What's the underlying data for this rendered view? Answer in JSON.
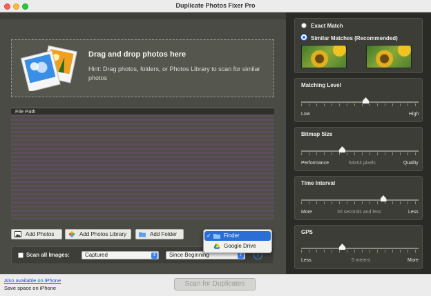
{
  "window": {
    "title": "Duplicate Photos Fixer Pro"
  },
  "dropzone": {
    "title": "Drag and drop photos here",
    "hint": "Hint: Drag photos, folders, or Photos Library to scan for similar photos"
  },
  "file_table": {
    "header": "File Path"
  },
  "buttons": {
    "add_photos": "Add Photos",
    "add_photos_library": "Add Photos Library",
    "add_folder": "Add Folder"
  },
  "source_menu": {
    "items": [
      {
        "label": "Finder",
        "checked": true,
        "icon": "folder-icon"
      },
      {
        "label": "Google Drive",
        "checked": false,
        "icon": "google-drive-icon"
      }
    ],
    "check_mark": "✓"
  },
  "scan_options": {
    "scan_all_label": "Scan all Images:",
    "date_type": "Captured",
    "date_range": "Since Beginning",
    "info_glyph": "i"
  },
  "match_mode": {
    "exact_label": "Exact Match",
    "similar_label": "Similar Matches (Recommended)",
    "selected": "similar"
  },
  "matching_level": {
    "title": "Matching Level",
    "min_label": "Low",
    "max_label": "High",
    "value_fraction": 0.55
  },
  "bitmap_size": {
    "title": "Bitmap Size",
    "min_label": "Performance",
    "mid_label": "64x64 pixels",
    "max_label": "Quality",
    "value_fraction": 0.35
  },
  "time_interval": {
    "title": "Time Interval",
    "min_label": "More",
    "mid_label": "30 seconds and less",
    "max_label": "Less",
    "value_fraction": 0.7
  },
  "gps": {
    "title": "GPS",
    "min_label": "Less",
    "mid_label": "5 meters",
    "max_label": "More",
    "value_fraction": 0.35
  },
  "footer": {
    "iphone_link": "Also available on iPhone",
    "iphone_sub": "Save space on iPhone",
    "scan_button": "Scan for Duplicates"
  },
  "colors": {
    "accent": "#2b6fd6",
    "panel_dark": "#2a2b27",
    "panel_mid": "#4a4b44"
  }
}
